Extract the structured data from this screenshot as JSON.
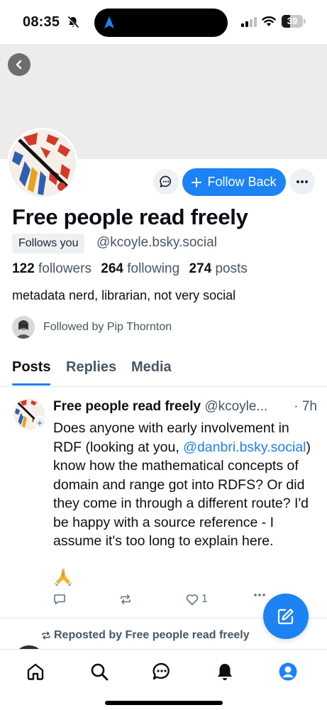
{
  "status_bar": {
    "time": "08:35",
    "battery_level": "39",
    "battery_fraction": 0.39
  },
  "profile": {
    "display_name": "Free people read freely",
    "follows_you_label": "Follows you",
    "handle": "@kcoyle.bsky.social",
    "followers_count": "122",
    "followers_label": "followers",
    "following_count": "264",
    "following_label": "following",
    "posts_count": "274",
    "posts_label": "posts",
    "bio": "metadata nerd, librarian, not very social",
    "followed_by": "Followed by Pip Thornton",
    "follow_button_label": "Follow Back"
  },
  "tabs": [
    {
      "label": "Posts",
      "active": true
    },
    {
      "label": "Replies",
      "active": false
    },
    {
      "label": "Media",
      "active": false
    }
  ],
  "post": {
    "author": "Free people read freely",
    "handle": "@kcoyle...",
    "time": "· 7h",
    "text_before": "Does anyone with early involvement in RDF (looking at you, ",
    "mention": "@danbri.bsky.social",
    "text_after": ") know how the mathematical concepts of domain and range got into RDFS? Or did they come in through a different route? I'd be happy with a source reference - I assume it's too long to explain here.",
    "emoji": "folded-hands-emoji",
    "like_count": "1"
  },
  "repost_line": "Reposted by Free people read freely",
  "colors": {
    "accent": "#1d83f2",
    "muted_text": "#475666",
    "banner": "#ececec"
  }
}
